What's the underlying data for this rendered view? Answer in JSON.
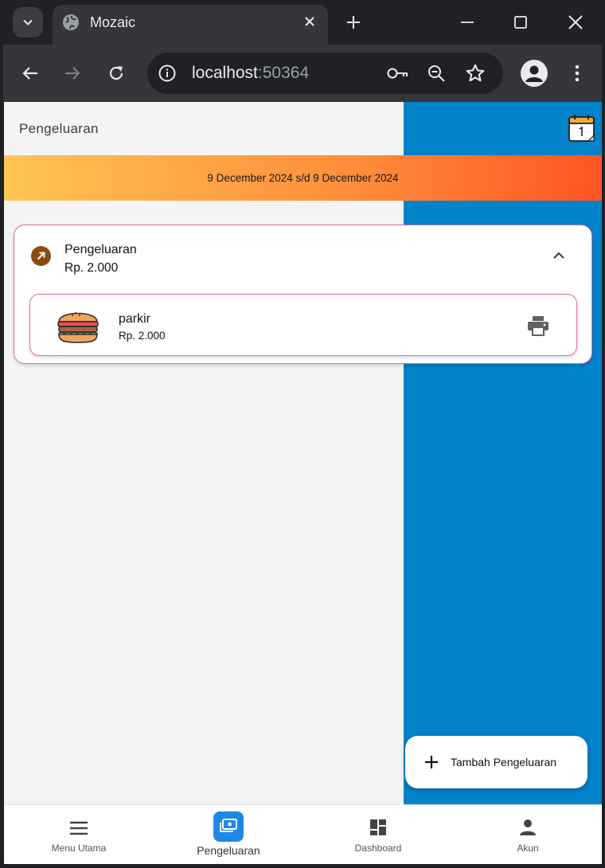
{
  "browser": {
    "tab_title": "Mozaic",
    "url_host": "localhost",
    "url_port": ":50364"
  },
  "header": {
    "title": "Pengeluaran"
  },
  "date_range": "9 December 2024 s/d 9 December 2024",
  "category": {
    "title": "Pengeluaran",
    "amount": "Rp. 2.000"
  },
  "items": [
    {
      "name": "parkir",
      "amount": "Rp. 2.000",
      "icon": "burger-icon"
    }
  ],
  "fab": {
    "label": "Tambah Pengeluaran"
  },
  "bottom_nav": {
    "menu_utama": "Menu Utama",
    "pengeluaran": "Pengeluaran",
    "dashboard": "Dashboard",
    "akun": "Akun"
  },
  "colors": {
    "accent_blue": "#0282c8",
    "nav_active": "#1e88e5",
    "card_border": "#e26ab0",
    "category_icon": "#8a4b12"
  }
}
